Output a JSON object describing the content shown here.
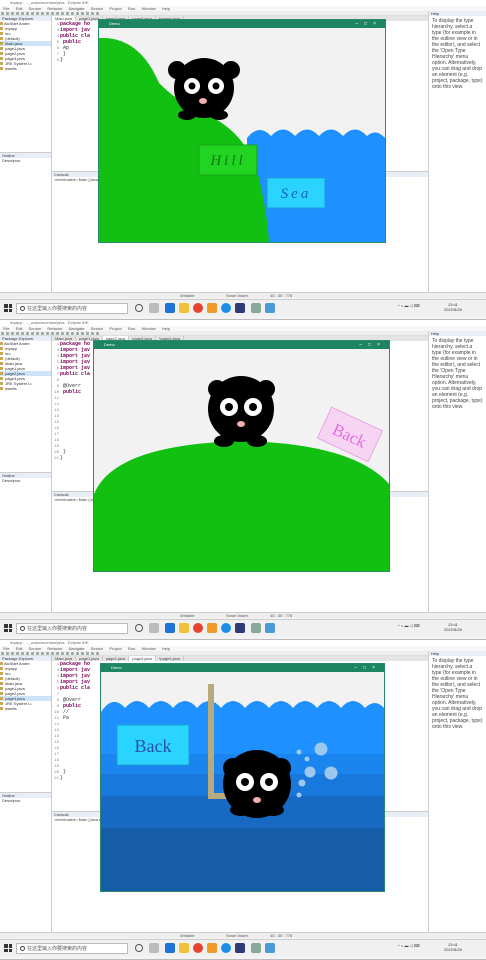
{
  "screens": [
    {
      "window_title": "myapp - ..._main/src/main/java - Eclipse IDE",
      "menu": [
        "File",
        "Edit",
        "Source",
        "Refactor",
        "Navigate",
        "Search",
        "Project",
        "Run",
        "Window",
        "Help"
      ],
      "package_explorer": {
        "header": "Package Explorer",
        "items": [
          "AlcStart Andre.",
          "  myapp",
          "    src",
          "      (default)",
          "        Main.java",
          "        page1.java",
          "        page2.java",
          "        page3.java",
          "  JRE System Li.",
          "  assets"
        ]
      },
      "editor_tabs": [
        "Main.java",
        "page1.java",
        "page2.java",
        "page3.java",
        "*page4.java"
      ],
      "code": [
        "package ho",
        "import jav",
        "public cla",
        "    public",
        "        Ap",
        "    }",
        "}"
      ],
      "frame": {
        "title": "Demo",
        "labels": [
          "Hill",
          "Sea"
        ]
      }
    },
    {
      "window_title": "myapp - ..._main/src/main/java - Eclipse IDE",
      "menu": [
        "File",
        "Edit",
        "Source",
        "Refactor",
        "Navigate",
        "Search",
        "Project",
        "Run",
        "Window",
        "Help"
      ],
      "package_explorer": {
        "header": "Package Explorer",
        "items": [
          "AlcStart Andre.",
          "  myapp",
          "    src",
          "      (default)",
          "        Main.java",
          "        page1.java",
          "        page2.java",
          "        page3.java",
          "  JRE System Li.",
          "  assets"
        ]
      },
      "editor_tabs": [
        "Main.java",
        "page1.java",
        "page2.java",
        "page3.java",
        "*page4.java"
      ],
      "code": [
        "package ho",
        "import jav",
        "import jav",
        "import jav",
        "import jav",
        "public cla",
        "",
        "    @Overr",
        "    public",
        "",
        "",
        "",
        "",
        "",
        "",
        "",
        "",
        "",
        "    }",
        "}"
      ],
      "frame": {
        "title": "Demo",
        "labels": [
          "Back"
        ]
      }
    },
    {
      "window_title": "myapp - ..._main/src/main/java - Eclipse IDE",
      "menu": [
        "File",
        "Edit",
        "Source",
        "Refactor",
        "Navigate",
        "Search",
        "Project",
        "Run",
        "Window",
        "Help"
      ],
      "package_explorer": {
        "header": "Package Explorer",
        "items": [
          "AlcStart Andre.",
          "  myapp",
          "    src",
          "      (default)",
          "        Main.java",
          "        page1.java",
          "        page2.java",
          "        page3.java",
          "  JRE System Li.",
          "  assets"
        ]
      },
      "editor_tabs": [
        "Main.java",
        "page1.java",
        "page2.java",
        "page3.java",
        "*page4.java"
      ],
      "code": [
        "package ho",
        "import jav",
        "import jav",
        "import jav",
        "public cla",
        "",
        "    @Overr",
        "    public",
        "        //",
        "        Pa",
        "",
        "",
        "",
        "",
        "",
        "",
        "",
        "",
        "    }",
        "}"
      ],
      "frame": {
        "title": "Demo",
        "labels": [
          "Back"
        ]
      }
    }
  ],
  "common": {
    "properties_header": "Outline",
    "properties_text": "Descriptor",
    "console_header": "Console",
    "console_text": "<terminated> Main [Java Application]",
    "help_header": "Help",
    "help_text": "To display the type hierarchy, select a type (for example in the outline view or in the editor), and select the 'Open Type Hierarchy' menu option. Alternatively, you can drag and drop an element (e.g. project, package, type) onto this view.",
    "status": [
      "Writable",
      "Smart Insert",
      "45 : 30 : 776"
    ],
    "search_placeholder": "在这里输入你要搜索的内容",
    "clock_time": "13:41",
    "clock_date": "2022/5/26",
    "colors": {
      "hill": "#11c011",
      "sea": "#1e90ff",
      "label_box": "#2ad4ff",
      "back_pink": "#ee82ee",
      "frame_bar": "#1e8563"
    }
  }
}
